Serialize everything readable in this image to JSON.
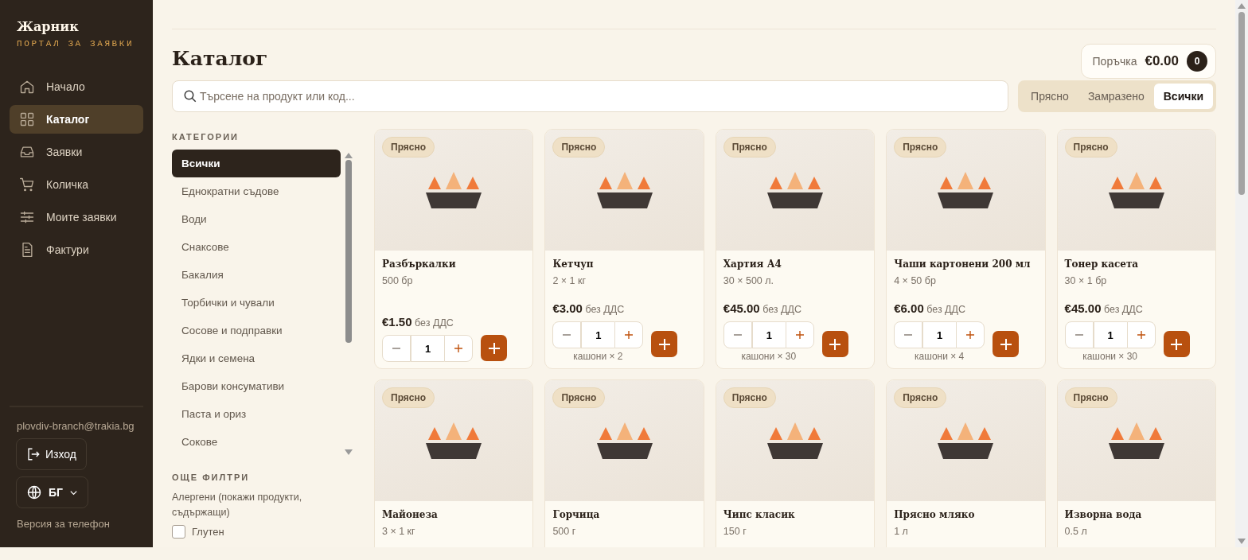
{
  "sidebar": {
    "brand": "Жарник",
    "subtitle": "ПОРТАЛ ЗА ЗАЯВКИ",
    "nav": [
      {
        "label": "Начало",
        "selected": false
      },
      {
        "label": "Каталог",
        "selected": true
      },
      {
        "label": "Заявки",
        "selected": false
      },
      {
        "label": "Количка",
        "selected": false
      },
      {
        "label": "Моите заявки",
        "selected": false
      },
      {
        "label": "Фактури",
        "selected": false
      }
    ],
    "email": "plovdiv-branch@trakia.bg",
    "logout": "Изход",
    "language": "БГ",
    "mobile_link": "Версия за телефон"
  },
  "page": {
    "title": "Каталог",
    "order": {
      "label": "Поръчка",
      "total": "€0.00",
      "count": "0"
    },
    "search": {
      "placeholder": "Търсене на продукт или код..."
    },
    "filters": [
      {
        "label": "Прясно",
        "selected": false
      },
      {
        "label": "Замразено",
        "selected": false
      },
      {
        "label": "Всички",
        "selected": true
      }
    ],
    "categories": {
      "heading": "КАТЕГОРИИ",
      "items": [
        {
          "label": "Всички",
          "selected": true
        },
        {
          "label": "Еднократни съдове",
          "selected": false
        },
        {
          "label": "Води",
          "selected": false
        },
        {
          "label": "Снаксове",
          "selected": false
        },
        {
          "label": "Бакалия",
          "selected": false
        },
        {
          "label": "Торбички и чували",
          "selected": false
        },
        {
          "label": "Сосове и подправки",
          "selected": false
        },
        {
          "label": "Ядки и семена",
          "selected": false
        },
        {
          "label": "Барови консумативи",
          "selected": false
        },
        {
          "label": "Паста и ориз",
          "selected": false
        },
        {
          "label": "Сокове",
          "selected": false
        }
      ]
    },
    "more_filters": {
      "heading": "ОЩЕ ФИЛТРИ",
      "allergens_label": "Алергени (покажи продукти, съдържащи)",
      "options": [
        {
          "label": "Глутен",
          "checked": false
        }
      ]
    },
    "products": [
      {
        "badge": "Прясно",
        "name": "Разбъркалки",
        "unit": "500 бр",
        "price": "€1.50",
        "vat_note": "без ДДС",
        "quantity": "1"
      },
      {
        "badge": "Прясно",
        "name": "Кетчуп",
        "unit": "2 × 1 кг",
        "price": "€3.00",
        "vat_note": "без ДДС",
        "quantity": "1",
        "pack_note": "кашони × 2"
      },
      {
        "badge": "Прясно",
        "name": "Хартия А4",
        "unit": "30 × 500 л.",
        "price": "€45.00",
        "vat_note": "без ДДС",
        "quantity": "1",
        "pack_note": "кашони × 30"
      },
      {
        "badge": "Прясно",
        "name": "Чаши картонени 200 мл",
        "unit": "4 × 50 бр",
        "price": "€6.00",
        "vat_note": "без ДДС",
        "quantity": "1",
        "pack_note": "кашони × 4"
      },
      {
        "badge": "Прясно",
        "name": "Тонер касета",
        "unit": "30 × 1 бр",
        "price": "€45.00",
        "vat_note": "без ДДС",
        "quantity": "1",
        "pack_note": "кашони × 30"
      },
      {
        "badge": "Прясно",
        "name": "Майонеза",
        "unit": "3 × 1 кг"
      },
      {
        "badge": "Прясно",
        "name": "Горчица",
        "unit": "500 г"
      },
      {
        "badge": "Прясно",
        "name": "Чипс класик",
        "unit": "150 г"
      },
      {
        "badge": "Прясно",
        "name": "Прясно мляко",
        "unit": "1 л"
      },
      {
        "badge": "Прясно",
        "name": "Изворна вода",
        "unit": "0.5 л"
      }
    ]
  }
}
